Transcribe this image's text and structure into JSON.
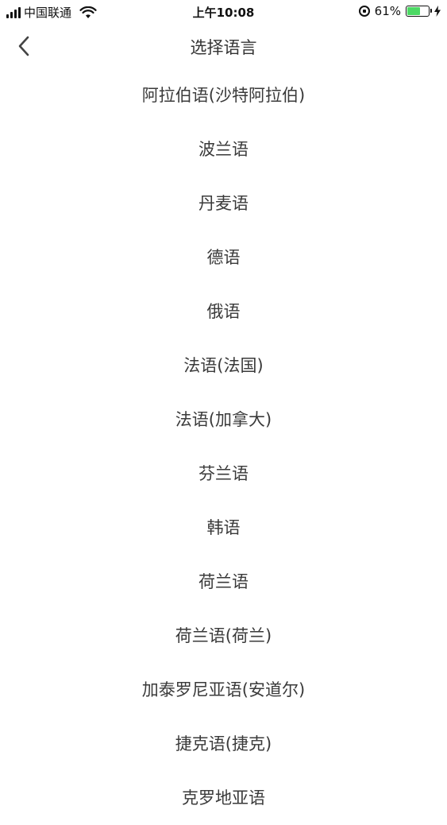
{
  "status_bar": {
    "carrier": "中国联通",
    "time": "上午10:08",
    "battery_percent": "61%",
    "battery_level": 0.61
  },
  "nav": {
    "title": "选择语言"
  },
  "languages": [
    "阿拉伯语(沙特阿拉伯)",
    "波兰语",
    "丹麦语",
    "德语",
    "俄语",
    "法语(法国)",
    "法语(加拿大)",
    "芬兰语",
    "韩语",
    "荷兰语",
    "荷兰语(荷兰)",
    "加泰罗尼亚语(安道尔)",
    "捷克语(捷克)",
    "克罗地亚语"
  ],
  "colors": {
    "battery_fill": "#4cd964",
    "text": "#3a3a3a"
  }
}
